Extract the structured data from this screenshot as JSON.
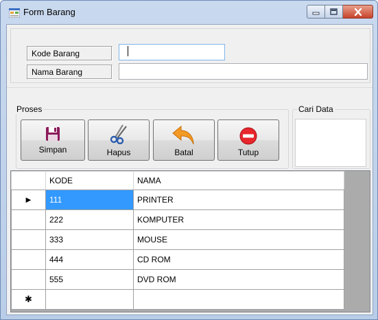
{
  "window": {
    "title": "Form Barang",
    "accent": "#3399ff"
  },
  "form": {
    "kode_label": "Kode Barang",
    "kode_value": "",
    "nama_label": "Nama Barang",
    "nama_value": ""
  },
  "proses": {
    "group_label": "Proses",
    "buttons": {
      "simpan": {
        "label": "Simpan",
        "icon": "floppy-disk-icon"
      },
      "hapus": {
        "label": "Hapus",
        "icon": "scissors-icon"
      },
      "batal": {
        "label": "Batal",
        "icon": "undo-arrow-icon"
      },
      "tutup": {
        "label": "Tutup",
        "icon": "stop-icon"
      }
    }
  },
  "cari": {
    "group_label": "Cari Data"
  },
  "grid": {
    "columns": [
      "KODE",
      "NAMA"
    ],
    "rows": [
      {
        "kode": "111",
        "nama": "PRINTER"
      },
      {
        "kode": "222",
        "nama": "KOMPUTER"
      },
      {
        "kode": "333",
        "nama": "MOUSE"
      },
      {
        "kode": "444",
        "nama": "CD ROM"
      },
      {
        "kode": "555",
        "nama": "DVD ROM"
      }
    ],
    "current_row_marker": "▶",
    "new_row_marker": "✱"
  }
}
